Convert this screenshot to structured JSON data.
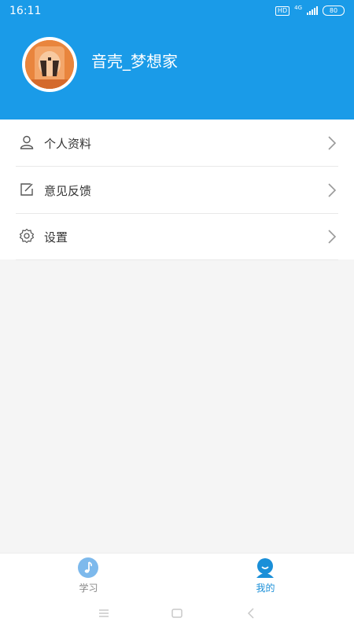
{
  "status_bar": {
    "time": "16:11",
    "network": "4G",
    "hd": "HD",
    "battery": "80"
  },
  "profile": {
    "username": "音壳_梦想家"
  },
  "menu": {
    "items": [
      {
        "label": "个人资料",
        "icon": "user-icon"
      },
      {
        "label": "意见反馈",
        "icon": "edit-icon"
      },
      {
        "label": "设置",
        "icon": "gear-icon"
      }
    ]
  },
  "tabs": [
    {
      "label": "学习",
      "icon": "music-note-icon",
      "active": false
    },
    {
      "label": "我的",
      "icon": "profile-icon",
      "active": true
    }
  ],
  "colors": {
    "primary": "#1a9be8",
    "active_tab": "#1a8fd8",
    "inactive_tab": "#888888"
  }
}
